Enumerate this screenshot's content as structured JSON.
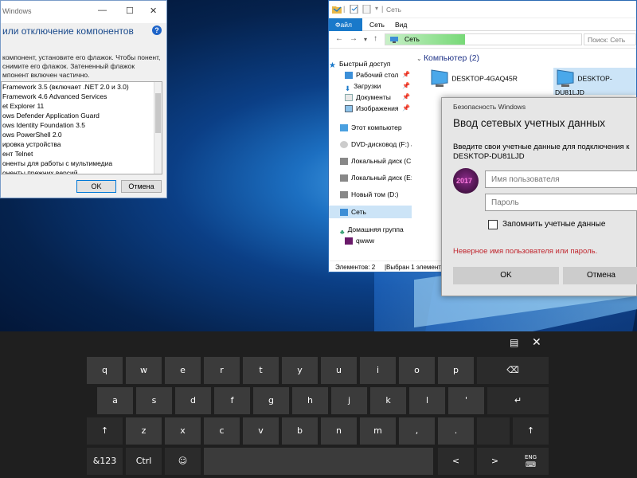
{
  "features_dialog": {
    "title": "Windows",
    "heading": "или отключение компонентов",
    "description": "компонент, установите его флажок. Чтобы понент, снимите его флажок. Затененный флажок мпонент включен частично.",
    "items": [
      "Framework 3.5 (включает .NET 2.0 и 3.0)",
      "Framework 4.6 Advanced Services",
      "et Explorer 11",
      "ows Defender Application Guard",
      "ows Identity Foundation 3.5",
      "ows PowerShell 2.0",
      "ировка устройства",
      "ент Telnet",
      "оненты для работы с мультимедиа",
      "оненты прежних версий"
    ],
    "ok": "OK",
    "cancel": "Отмена"
  },
  "explorer": {
    "title": "Сеть",
    "ribbon_tabs": [
      "Файл",
      "Сеть",
      "Вид"
    ],
    "address": "Сеть",
    "search_placeholder": "Поиск: Сеть",
    "sidebar": [
      "Быстрый доступ",
      "Рабочий стол",
      "Загрузки",
      "Документы",
      "Изображения",
      "Этот компьютер",
      "DVD-дисковод (F:) J_",
      "Локальный диск (C:)",
      "Локальный диск (E:)",
      "Новый том (D:)",
      "Сеть",
      "Домашняя группа",
      "qwww"
    ],
    "group_header": "Компьютер (2)",
    "computers": [
      "DESKTOP-4GAQ45R",
      "DESKTOP-DU81LJD"
    ],
    "status_items": "Элементов: 2",
    "status_selected": "Выбран 1 элемент"
  },
  "security_dialog": {
    "caption": "Безопасность Windows",
    "heading": "Ввод сетевых учетных данных",
    "intro_line1": "Введите свои учетные данные для подключения к",
    "intro_line2": "DESKTOP-DU81LJD",
    "avatar_text": "2017",
    "username_placeholder": "Имя пользователя",
    "password_placeholder": "Пароль",
    "remember_label": "Запомнить учетные данные",
    "error": "Неверное имя пользователя или пароль.",
    "ok": "OK",
    "cancel": "Отмена"
  },
  "keyboard": {
    "row1": [
      "q",
      "w",
      "e",
      "r",
      "t",
      "y",
      "u",
      "i",
      "o",
      "p"
    ],
    "row2": [
      "a",
      "s",
      "d",
      "f",
      "g",
      "h",
      "j",
      "k",
      "l",
      "'"
    ],
    "row3": [
      "z",
      "x",
      "c",
      "v",
      "b",
      "n",
      "m",
      ",",
      "."
    ],
    "sym_label": "&123",
    "ctrl_label": "Ctrl",
    "lang_label": "ENG",
    "backspace_icon": "⌫",
    "enter_icon": "↵",
    "shift_icon": "↑",
    "emoji_icon": "☺",
    "left_icon": "<",
    "right_icon": ">",
    "dock_icon": "▤",
    "close_icon": "✕"
  }
}
